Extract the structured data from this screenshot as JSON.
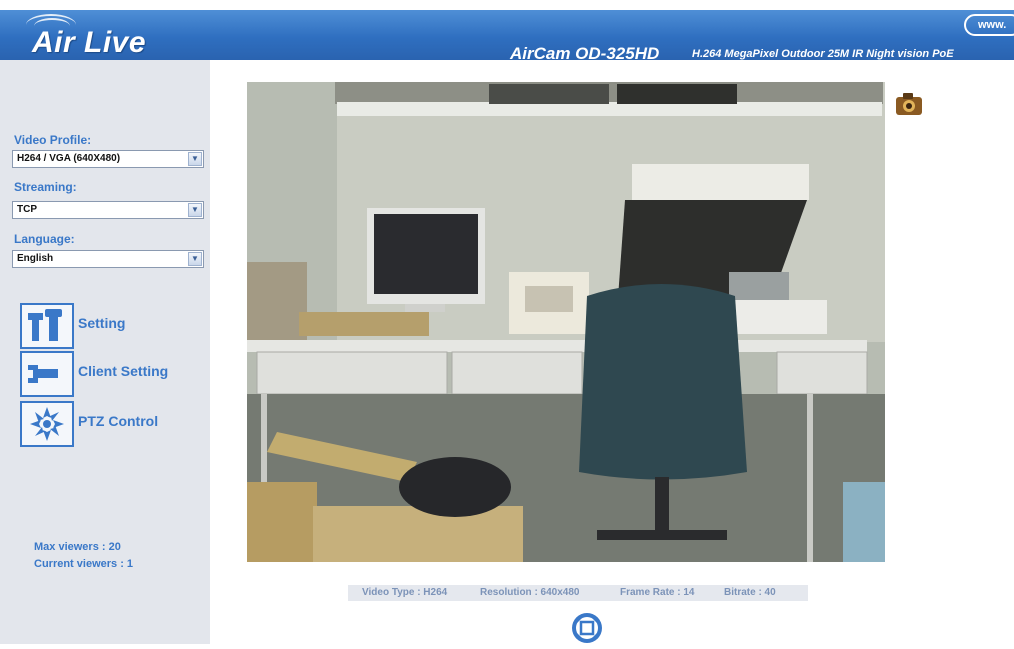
{
  "header": {
    "logo": "Air Live",
    "model": "AirCam OD-325HD",
    "description": "H.264 MegaPixel Outdoor 25M IR Night vision PoE",
    "www_badge": "www."
  },
  "sidebar": {
    "video_profile": {
      "label": "Video Profile:",
      "value": "H264 / VGA (640X480)"
    },
    "streaming": {
      "label": "Streaming:",
      "value": "TCP"
    },
    "language": {
      "label": "Language:",
      "value": "English"
    },
    "menu": [
      {
        "label": "Setting",
        "icon": "tools-icon"
      },
      {
        "label": "Client Setting",
        "icon": "wrench-icon"
      },
      {
        "label": "PTZ Control",
        "icon": "ptz-star-icon"
      }
    ],
    "max_viewers": "Max viewers : 20",
    "current_viewers": "Current viewers : 1"
  },
  "video_info": {
    "video_type": "Video Type : H264",
    "resolution": "Resolution : 640x480",
    "frame_rate": "Frame Rate : 14",
    "bitrate": "Bitrate : 40"
  },
  "colors": {
    "header_blue": "#2f6fc0",
    "sidebar_bg": "#e3e6ec",
    "accent_blue": "#3a78c8"
  }
}
